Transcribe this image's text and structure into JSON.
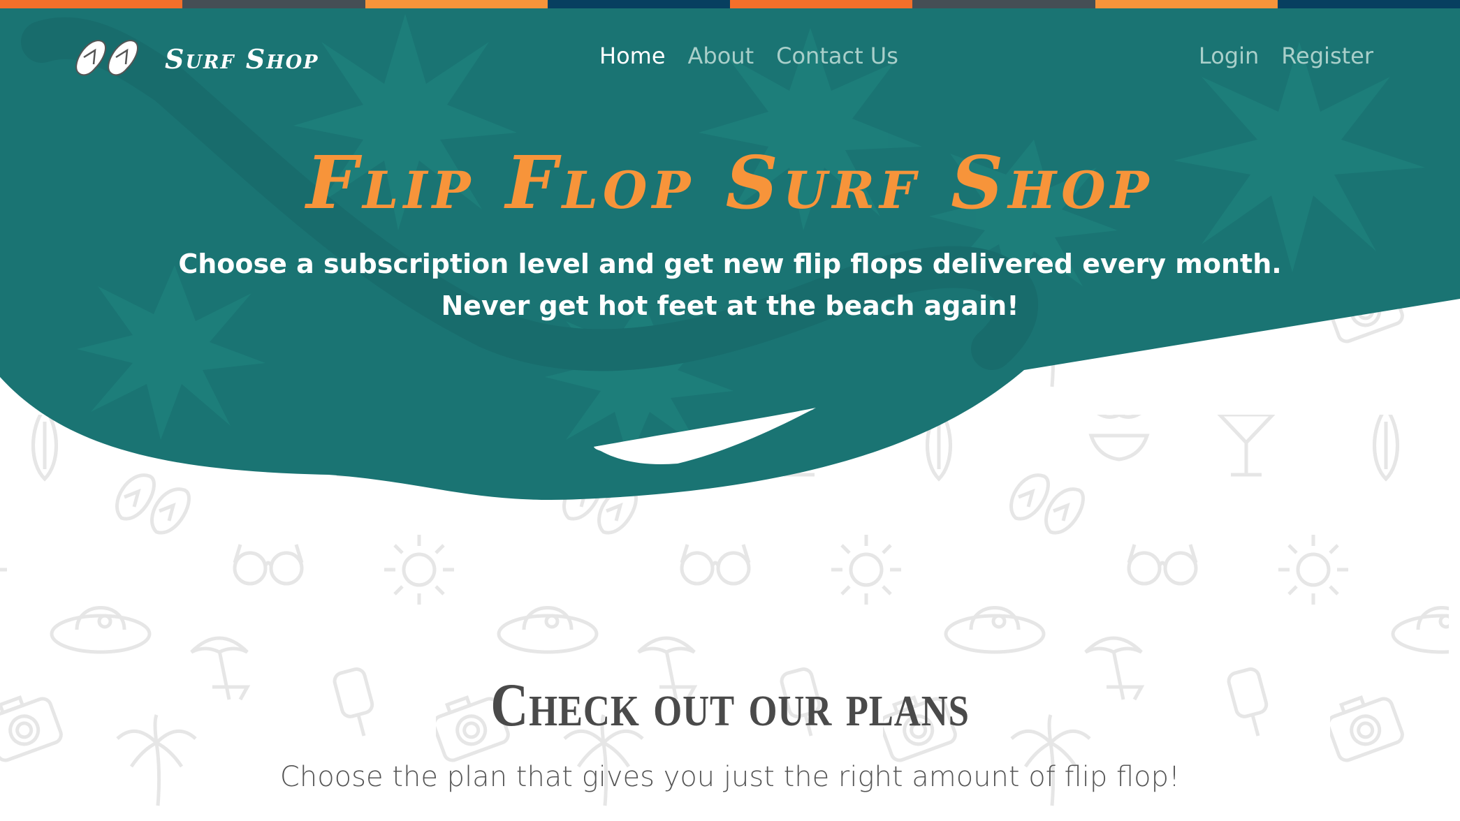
{
  "top_bar": {
    "colors": [
      "#f46f2a",
      "#454e55",
      "#f7943a",
      "#073f60",
      "#f46f2a",
      "#454e55",
      "#f7943a",
      "#073f60"
    ]
  },
  "colors": {
    "teal": "#1a7473",
    "teal_dark": "#186b6b",
    "orange": "#f7943a",
    "pattern_gray": "#e8e8e8"
  },
  "brand": {
    "name": "Surf Shop",
    "logo_icon": "flip-flops-icon"
  },
  "nav": {
    "links": [
      {
        "label": "Home",
        "active": true
      },
      {
        "label": "About",
        "active": false
      },
      {
        "label": "Contact Us",
        "active": false
      }
    ],
    "auth": [
      {
        "label": "Login"
      },
      {
        "label": "Register"
      }
    ]
  },
  "hero": {
    "title": "Flip Flop Surf Shop",
    "subtitle_line1": "Choose a subscription level and get new flip flops delivered every month.",
    "subtitle_line2": "Never get hot feet at the beach again!"
  },
  "plans": {
    "heading": "Check out our plans",
    "subheading": "Choose the plan that gives you just the right amount of flip flop!"
  },
  "background_pattern_icons": [
    "surfboard-icon",
    "bikini-icon",
    "cocktail-icon",
    "flip-flops-icon",
    "sunglasses-icon",
    "sun-icon",
    "sun-hat-icon",
    "beach-umbrella-icon",
    "popsicle-icon",
    "camera-icon",
    "palm-tree-icon"
  ]
}
